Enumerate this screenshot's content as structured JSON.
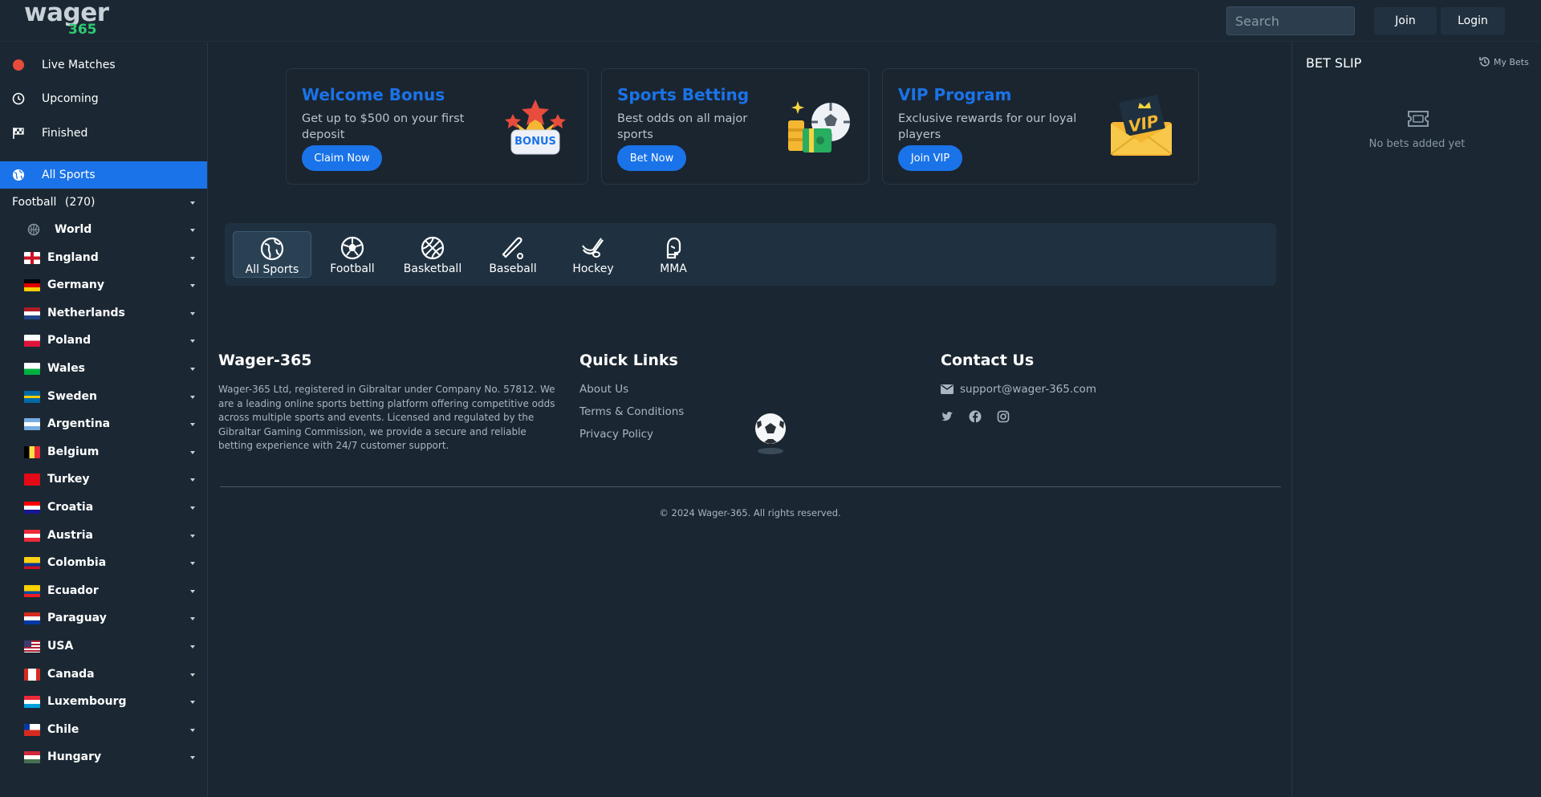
{
  "header": {
    "logo_word": "wager",
    "logo_num": "365",
    "search_placeholder": "Search",
    "join_label": "Join",
    "login_label": "Login"
  },
  "sidebar": {
    "live": "Live Matches",
    "upcoming": "Upcoming",
    "finished": "Finished",
    "all_sports": "All Sports",
    "football": "Football",
    "football_count": "(270)",
    "countries": [
      "World",
      "England",
      "Germany",
      "Netherlands",
      "Poland",
      "Wales",
      "Sweden",
      "Argentina",
      "Belgium",
      "Turkey",
      "Croatia",
      "Austria",
      "Colombia",
      "Ecuador",
      "Paraguay",
      "USA",
      "Canada",
      "Luxembourg",
      "Chile",
      "Hungary"
    ]
  },
  "promos": [
    {
      "title": "Welcome Bonus",
      "line1": "Get up to $500 on your first",
      "line2": "deposit",
      "button": "Claim Now",
      "badge": "BONUS"
    },
    {
      "title": "Sports Betting",
      "line1": "Best odds on all major",
      "line2": "sports",
      "button": "Bet Now"
    },
    {
      "title": "VIP Program",
      "line1": "Exclusive rewards for our loyal",
      "line2": "players",
      "button": "Join VIP",
      "badge": "VIP"
    }
  ],
  "sports": [
    "All Sports",
    "Football",
    "Basketball",
    "Baseball",
    "Hockey",
    "MMA"
  ],
  "footer": {
    "brand_title": "Wager-365",
    "description": "Wager-365 Ltd, registered in Gibraltar under Company No. 57812. We are a leading online sports betting platform offering competitive odds across multiple sports and events. Licensed and regulated by the Gibraltar Gaming Commission, we provide a secure and reliable betting experience with 24/7 customer support.",
    "links_title": "Quick Links",
    "links": [
      "About Us",
      "Terms & Conditions",
      "Privacy Policy"
    ],
    "contact_title": "Contact Us",
    "email": "support@wager-365.com",
    "copyright": "© 2024 Wager-365. All rights reserved."
  },
  "betslip": {
    "title": "BET SLIP",
    "my_bets": "My Bets",
    "empty": "No bets added yet"
  },
  "colors": {
    "accent": "#1a73e8",
    "brand_green": "#2ecc71",
    "live": "#e74c3c"
  }
}
